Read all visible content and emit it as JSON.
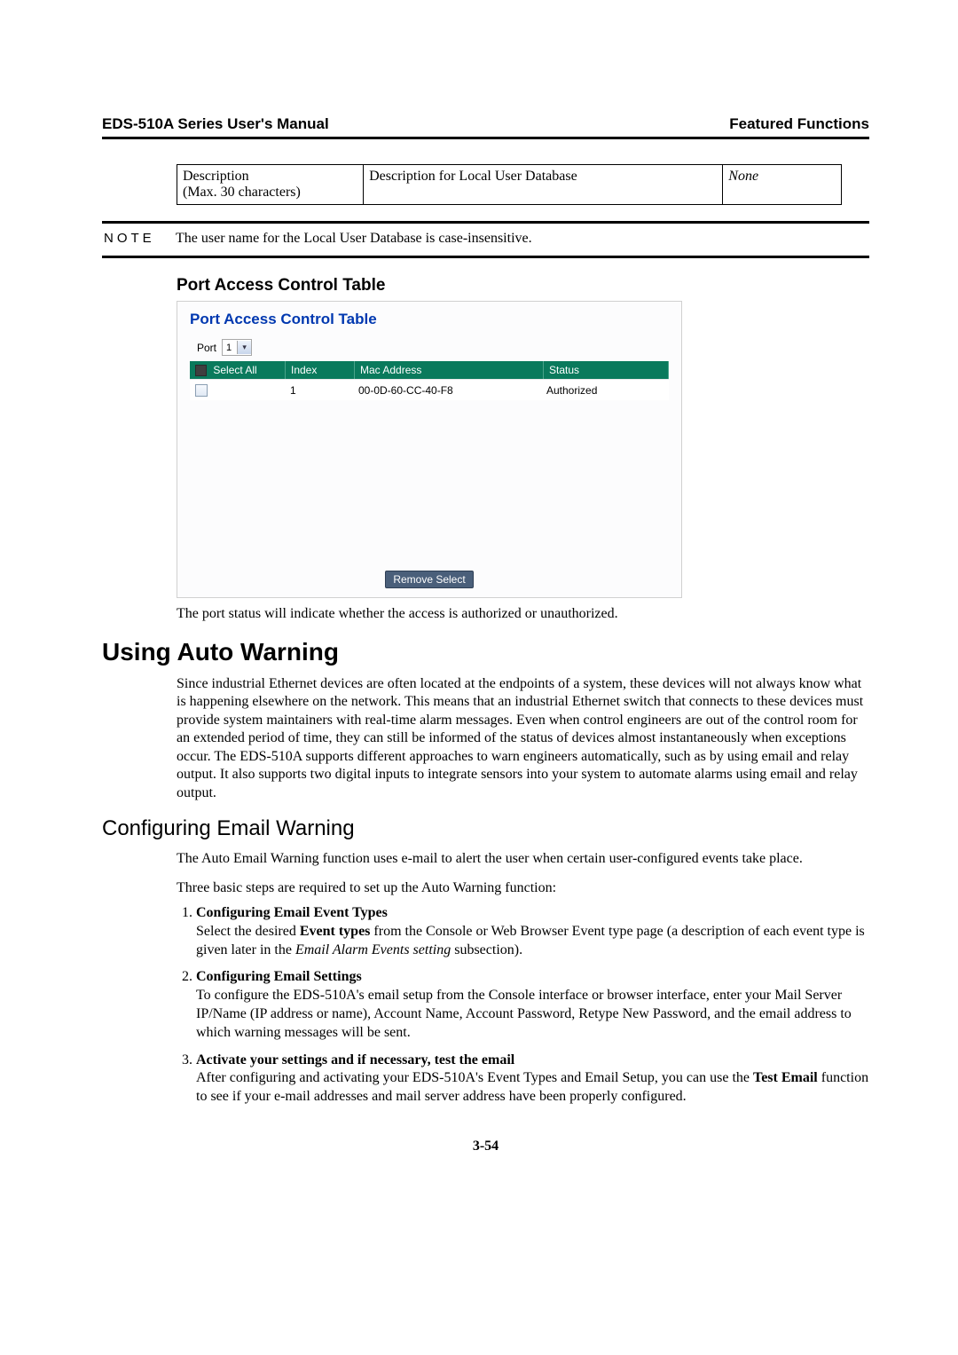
{
  "header": {
    "left": "EDS-510A Series User's Manual",
    "right": "Featured Functions"
  },
  "desc_table": {
    "col1_line1": "Description",
    "col1_line2": "(Max. 30 characters)",
    "col2": "Description for Local User Database",
    "col3": "None"
  },
  "note": {
    "label": "NOTE",
    "text": "The user name for the Local User Database is case-insensitive."
  },
  "section_pact_heading": "Port Access Control Table",
  "screenshot": {
    "title": "Port Access Control Table",
    "port_label": "Port",
    "port_value": "1",
    "headers": {
      "select_all": "Select All",
      "index": "Index",
      "mac": "Mac Address",
      "status": "Status"
    },
    "rows": [
      {
        "index": "1",
        "mac": "00-0D-60-CC-40-F8",
        "status": "Authorized"
      }
    ],
    "remove_btn": "Remove Select"
  },
  "pact_caption": "The port status will indicate whether the access is authorized or unauthorized.",
  "h1_auto_warning": "Using Auto Warning",
  "auto_warning_para": "Since industrial Ethernet devices are often located at the endpoints of a system, these devices will not always know what is happening elsewhere on the network. This means that an industrial Ethernet switch that connects to these devices must provide system maintainers with real-time alarm messages. Even when control engineers are out of the control room for an extended period of time, they can still be informed of the status of devices almost instantaneously when exceptions occur. The EDS-510A supports different approaches to warn engineers automatically, such as by using email and relay output. It also supports two digital inputs to integrate sensors into your system to automate alarms using email and relay output.",
  "h2_email": "Configuring Email Warning",
  "email_para1": "The Auto Email Warning function uses e-mail to alert the user when certain user-configured events take place.",
  "email_para2": "Three basic steps are required to set up the Auto Warning function:",
  "steps": [
    {
      "title": "Configuring Email Event Types",
      "body_pre": "Select the desired ",
      "body_bold1": "Event types",
      "body_mid": " from the Console or Web Browser Event type page (a description of each event type is given later in the ",
      "body_ital": "Email Alarm Events setting",
      "body_post": " subsection)."
    },
    {
      "title": "Configuring Email Settings",
      "body": "To configure the EDS-510A's email setup from the Console interface or browser interface, enter your Mail Server IP/Name (IP address or name), Account Name, Account Password, Retype New Password, and the email address to which warning messages will be sent."
    },
    {
      "title": "Activate your settings and if necessary, test the email",
      "body_pre": "After configuring and activating your EDS-510A's Event Types and Email Setup, you can use the ",
      "body_bold1": "Test Email",
      "body_post": " function to see if your e-mail addresses and mail server address have been properly configured."
    }
  ],
  "page_number": "3-54"
}
